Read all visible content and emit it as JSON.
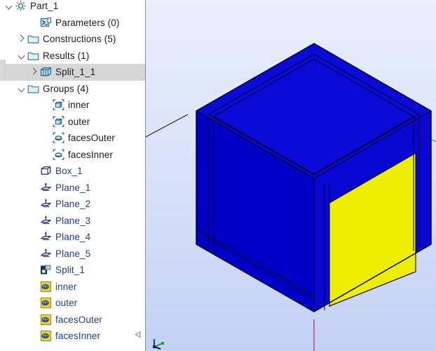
{
  "tree": {
    "name": "object-browser",
    "rows": [
      {
        "label": "Part_1",
        "indent": 0,
        "twisty": "down",
        "icon": "gear-icon",
        "style": "plain",
        "selected": false
      },
      {
        "label": "Parameters (0)",
        "indent": 2,
        "twisty": "none",
        "icon": "parameters-icon",
        "style": "plain",
        "selected": false
      },
      {
        "label": "Constructions (5)",
        "indent": 1,
        "twisty": "right",
        "icon": "folder-icon",
        "style": "plain",
        "selected": false
      },
      {
        "label": "Results (1)",
        "indent": 1,
        "twisty": "down",
        "icon": "folder-icon",
        "style": "plain",
        "selected": false
      },
      {
        "label": "Split_1_1",
        "indent": 2,
        "twisty": "right",
        "icon": "solid-icon",
        "style": "plain",
        "selected": true
      },
      {
        "label": "Groups (4)",
        "indent": 1,
        "twisty": "down",
        "icon": "folder-icon",
        "style": "plain",
        "selected": false
      },
      {
        "label": "inner",
        "indent": 3,
        "twisty": "none",
        "icon": "group-solid-icon",
        "style": "plain",
        "selected": false
      },
      {
        "label": "outer",
        "indent": 3,
        "twisty": "none",
        "icon": "group-solid-icon",
        "style": "plain",
        "selected": false
      },
      {
        "label": "facesOuter",
        "indent": 3,
        "twisty": "none",
        "icon": "group-face-icon",
        "style": "plain",
        "selected": false
      },
      {
        "label": "facesInner",
        "indent": 3,
        "twisty": "none",
        "icon": "group-face-icon",
        "style": "plain",
        "selected": false
      },
      {
        "label": "Box_1",
        "indent": 2,
        "twisty": "none",
        "icon": "box-icon",
        "style": "link",
        "selected": false
      },
      {
        "label": "Plane_1",
        "indent": 2,
        "twisty": "none",
        "icon": "plane-icon",
        "style": "link",
        "selected": false
      },
      {
        "label": "Plane_2",
        "indent": 2,
        "twisty": "none",
        "icon": "plane-icon",
        "style": "link",
        "selected": false
      },
      {
        "label": "Plane_3",
        "indent": 2,
        "twisty": "none",
        "icon": "plane-icon",
        "style": "link",
        "selected": false
      },
      {
        "label": "Plane_4",
        "indent": 2,
        "twisty": "none",
        "icon": "plane-icon",
        "style": "link",
        "selected": false
      },
      {
        "label": "Plane_5",
        "indent": 2,
        "twisty": "none",
        "icon": "plane-icon",
        "style": "link",
        "selected": false
      },
      {
        "label": "Split_1",
        "indent": 2,
        "twisty": "none",
        "icon": "split-icon",
        "style": "link",
        "selected": false
      },
      {
        "label": "inner",
        "indent": 2,
        "twisty": "none",
        "icon": "mesh-group-icon",
        "style": "link",
        "selected": false
      },
      {
        "label": "outer",
        "indent": 2,
        "twisty": "none",
        "icon": "mesh-group-icon",
        "style": "link",
        "selected": false
      },
      {
        "label": "facesOuter",
        "indent": 2,
        "twisty": "none",
        "icon": "mesh-group-icon",
        "style": "link",
        "selected": false
      },
      {
        "label": "facesInner",
        "indent": 2,
        "twisty": "none",
        "icon": "mesh-group-icon",
        "style": "link",
        "selected": false
      }
    ]
  },
  "viewport": {
    "name": "3d-viewport",
    "background_top": "#e9eefb",
    "background_bottom": "#c4d2f4",
    "model": {
      "name": "split-box-model",
      "solid_color": "#0000dd",
      "solid_color_dark": "#0000b4",
      "solid_color_light": "#1414f0",
      "selected_face_color": "#eeee00",
      "edge_color": "#000033"
    },
    "axes": {
      "x_axis_color": "#cc2244",
      "y_axis_color": "#22aa44",
      "z_axis_color": "#222222"
    },
    "trihedron_label": "origin-trihedron"
  },
  "colors": {
    "selection_highlight": "#d6d6d6",
    "tree_link_text": "#1f3f8f",
    "tree_text": "#1b1b1b",
    "panel_border": "#8d8d8d"
  }
}
